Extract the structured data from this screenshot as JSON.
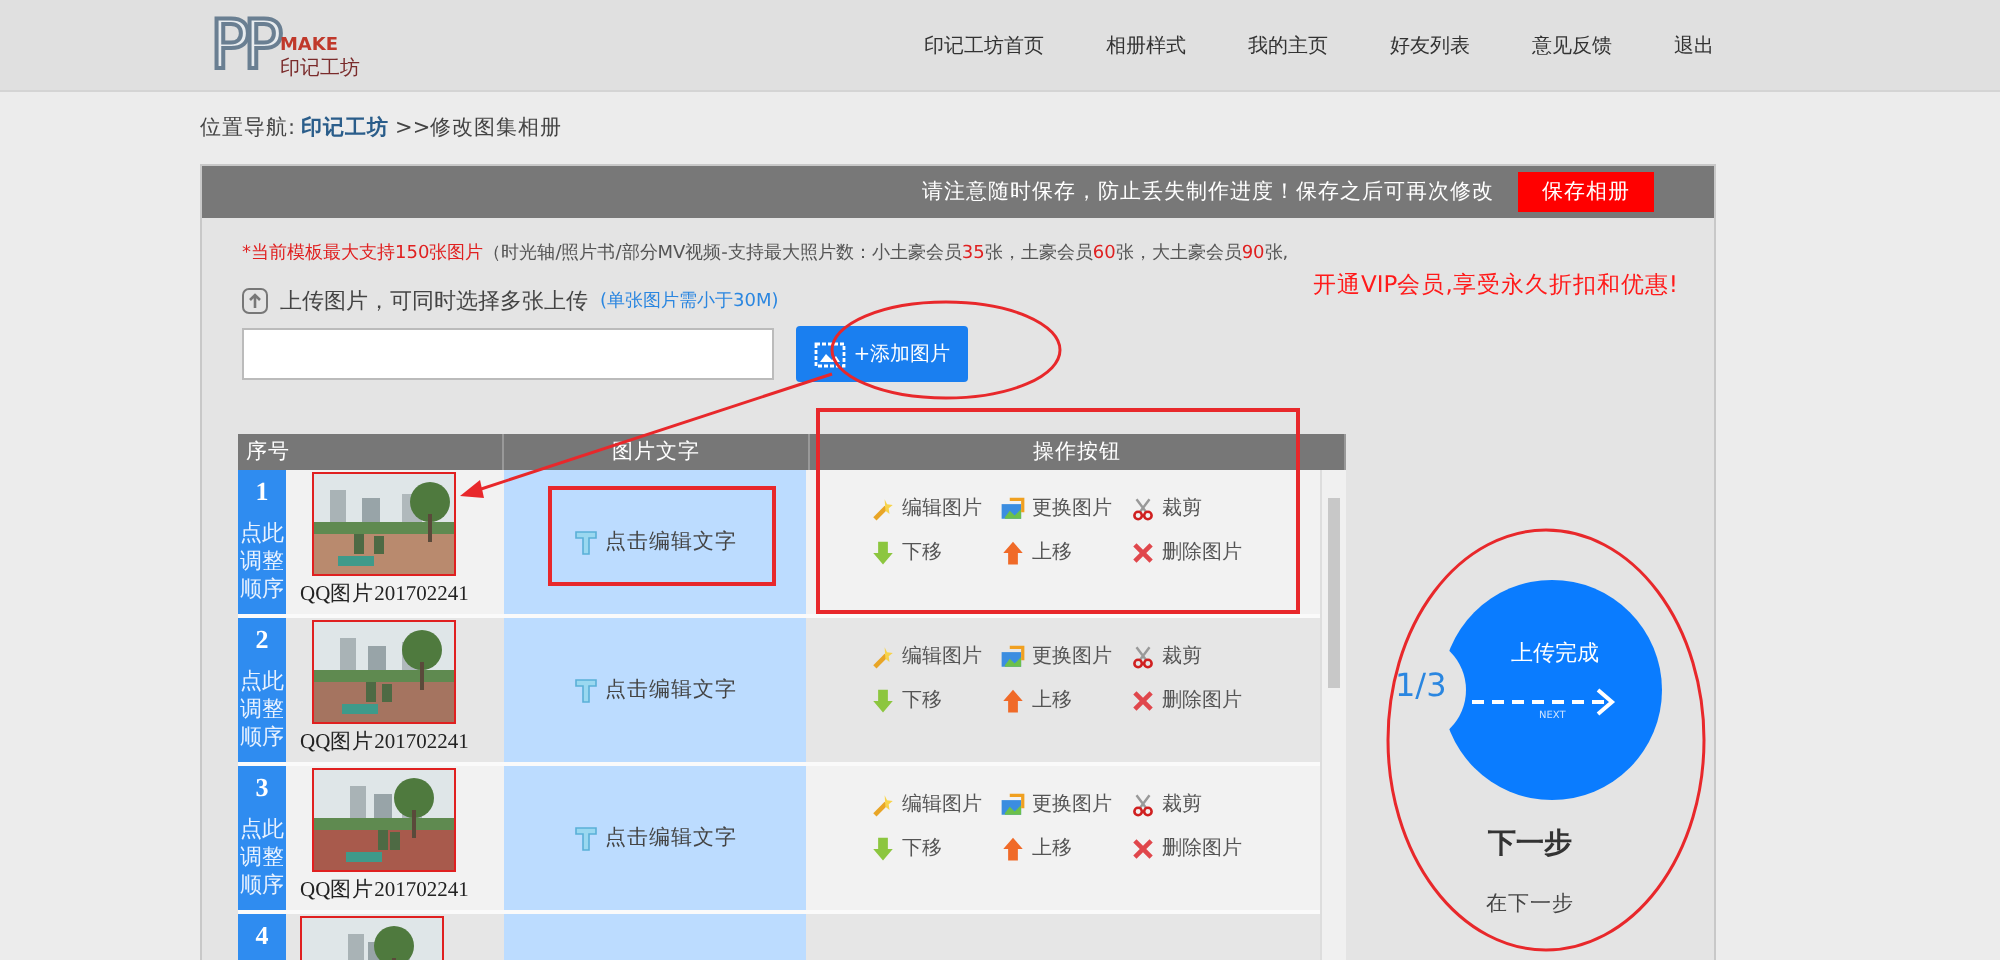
{
  "header": {
    "logo": {
      "letters": "PP",
      "tag": "MAKE",
      "name": "印记工坊"
    },
    "nav": [
      {
        "label": "印记工坊首页"
      },
      {
        "label": "相册样式"
      },
      {
        "label": "我的主页"
      },
      {
        "label": "好友列表"
      },
      {
        "label": "意见反馈"
      },
      {
        "label": "退出"
      }
    ]
  },
  "breadcrumb": {
    "label": "位置导航:",
    "link": "印记工坊",
    "current": ">>修改图集相册"
  },
  "save_bar": {
    "notice": "请注意随时保存，防止丢失制作进度！保存之后可再次修改",
    "button": "保存相册"
  },
  "info": [
    {
      "text": "*当前模板最大支持150张图片",
      "highlight": true
    },
    {
      "text": "（时光轴/照片书/部分MV视频-支持最大照片数：小土豪会员",
      "highlight": false
    },
    {
      "text": "35",
      "highlight": true
    },
    {
      "text": "张，土豪会员",
      "highlight": false
    },
    {
      "text": "60",
      "highlight": true
    },
    {
      "text": "张，大土豪会员",
      "highlight": false
    },
    {
      "text": "90",
      "highlight": true
    },
    {
      "text": "张,",
      "highlight": false
    }
  ],
  "vip_promo": "开通VIP会员,享受永久折扣和优惠!",
  "upload": {
    "label": "上传图片，可同时选择多张上传",
    "note": "(单张图片需小于30M)",
    "button": "+添加图片"
  },
  "table": {
    "columns": [
      "序号",
      "图片文字",
      "操作按钮"
    ],
    "rows": [
      {
        "number": "1",
        "order_label": "点此调整顺序",
        "caption": "QQ图片201702241",
        "text_button": "点击编辑文字",
        "actions": [
          {
            "kind": "edit",
            "label": "编辑图片"
          },
          {
            "kind": "replace",
            "label": "更换图片"
          },
          {
            "kind": "crop",
            "label": "裁剪"
          },
          {
            "kind": "down",
            "label": "下移"
          },
          {
            "kind": "up",
            "label": "上移"
          },
          {
            "kind": "delete",
            "label": "删除图片"
          }
        ]
      },
      {
        "number": "2",
        "order_label": "点此调整顺序",
        "caption": "QQ图片201702241",
        "text_button": "点击编辑文字",
        "actions": [
          {
            "kind": "edit",
            "label": "编辑图片"
          },
          {
            "kind": "replace",
            "label": "更换图片"
          },
          {
            "kind": "crop",
            "label": "裁剪"
          },
          {
            "kind": "down",
            "label": "下移"
          },
          {
            "kind": "up",
            "label": "上移"
          },
          {
            "kind": "delete",
            "label": "删除图片"
          }
        ]
      },
      {
        "number": "3",
        "order_label": "点此调整顺序",
        "caption": "QQ图片201702241",
        "text_button": "点击编辑文字",
        "actions": [
          {
            "kind": "edit",
            "label": "编辑图片"
          },
          {
            "kind": "replace",
            "label": "更换图片"
          },
          {
            "kind": "crop",
            "label": "裁剪"
          },
          {
            "kind": "down",
            "label": "下移"
          },
          {
            "kind": "up",
            "label": "上移"
          },
          {
            "kind": "delete",
            "label": "删除图片"
          }
        ]
      },
      {
        "number": "4"
      }
    ]
  },
  "next": {
    "counter": "1/3",
    "title": "上传完成",
    "sub": "NEXT",
    "label": "下一步",
    "hint": "在下一步"
  }
}
